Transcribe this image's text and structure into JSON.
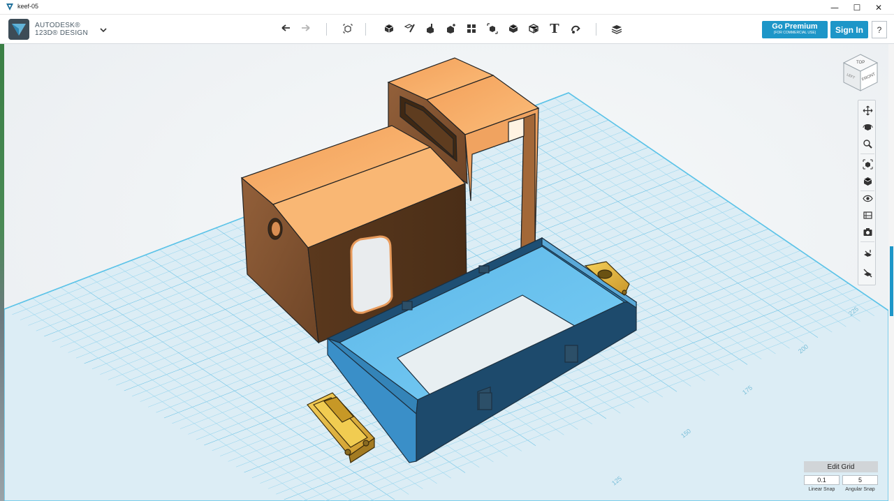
{
  "window": {
    "title": "keef-05",
    "minimize_symbol": "—",
    "maximize_symbol": "☐",
    "close_symbol": "✕"
  },
  "brand": {
    "line1": "AUTODESK®",
    "line2": "123D® DESIGN",
    "menu_icon": "chevron-down-icon"
  },
  "toolbar": {
    "tools": [
      "undo-icon",
      "redo-icon",
      "transform-icon",
      "primitives-icon",
      "sketch-icon",
      "construct-icon",
      "modify-icon",
      "pattern-icon",
      "grouping-icon",
      "combine-icon",
      "measure-icon",
      "text-icon",
      "snap-icon",
      "material-icon"
    ],
    "text_tool_glyph": "T"
  },
  "account": {
    "premium_label": "Go Premium",
    "premium_sub": "(FOR COMMERCIAL USE)",
    "signin_label": "Sign In",
    "help_label": "?"
  },
  "viewcube": {
    "top_label": "TOP",
    "front_label": "FRONT",
    "left_label": "LEFT"
  },
  "navbar": {
    "tools": [
      "pan-icon",
      "orbit-icon",
      "zoom-icon",
      "fit-icon",
      "views-icon",
      "visibility-icon",
      "materials-outlines-icon",
      "camera-icon",
      "grid-snap-icon",
      "hide-grid-icon"
    ]
  },
  "grid": {
    "edit_label": "Edit Grid",
    "linear_value": "0.1",
    "angular_value": "5",
    "linear_label": "Linear Snap",
    "angular_label": "Angular Snap",
    "ruler_labels": [
      "225",
      "200",
      "175",
      "150",
      "125"
    ]
  },
  "colors": {
    "accent": "#1d96c8",
    "cab_top": "#f5a25c",
    "cab_side": "#8a5a35",
    "chassis": "#3f8fc4",
    "parts": "#e8b93a"
  }
}
